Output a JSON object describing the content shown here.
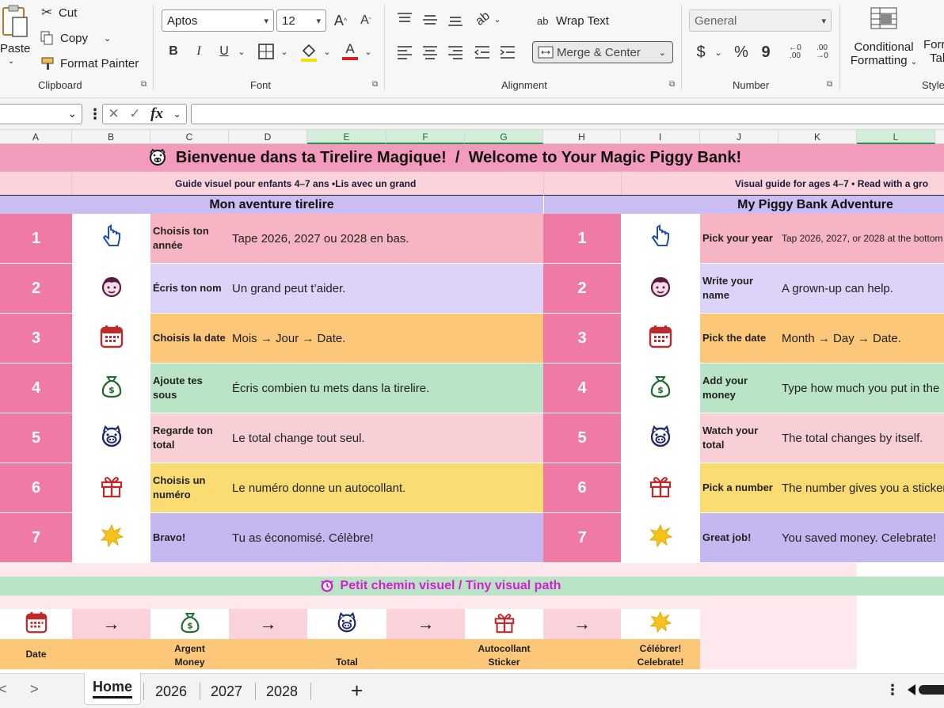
{
  "ribbon": {
    "clipboard": {
      "paste_label": "Paste",
      "cut_label": "Cut",
      "copy_label": "Copy",
      "format_painter_label": "Format Painter",
      "group_label": "Clipboard"
    },
    "font": {
      "font_name": "Aptos",
      "font_size": "12",
      "grow_label": "A",
      "shrink_label": "A",
      "bold_label": "B",
      "italic_label": "I",
      "underline_label": "U",
      "font_color_label": "A",
      "group_label": "Font"
    },
    "alignment": {
      "wrap_text_label": "Wrap Text",
      "wrap_text_glyph": "ab",
      "merge_center_label": "Merge & Center",
      "group_label": "Alignment"
    },
    "number": {
      "format_value": "General",
      "currency_label": "$",
      "percent_label": "%",
      "comma_label": "9",
      "increase_decimal_label": ".00",
      "decrease_decimal_label": ".00",
      "group_label": "Number"
    },
    "styles": {
      "conditional_formatting_line1": "Conditional",
      "conditional_formatting_line2": "Formatting",
      "format_table_line1": "Forr",
      "format_table_line2": "Tal",
      "group_label": "Style"
    }
  },
  "formula_bar": {
    "fx_label": "fx",
    "more_label": "⋮",
    "cancel_label": "✕",
    "enter_label": "✓"
  },
  "columns": [
    "A",
    "B",
    "C",
    "D",
    "E",
    "F",
    "G",
    "H",
    "I",
    "J",
    "K",
    "L"
  ],
  "sheet": {
    "title": "Bienvenue dans ta Tirelire Magique!  /  Welcome to Your Magic Piggy Bank!",
    "subtitle_fr": "Guide visuel pour enfants 4–7 ans •Lis avec un grand",
    "subtitle_en": "Visual guide for ages 4–7  • Read with a gro",
    "header_fr": "Mon aventure tirelire",
    "header_en": "My Piggy Bank Adventure",
    "steps": [
      {
        "num": "1",
        "icon": "pointing-hand-icon",
        "fr_title": "Choisis ton année",
        "fr_desc": "Tape 2026, 2027 ou 2028 en bas.",
        "en_title": "Pick your year",
        "en_desc": "Tap 2026, 2027, or 2028 at the bottom"
      },
      {
        "num": "2",
        "icon": "child-face-icon",
        "fr_title": "Écris ton nom",
        "fr_desc": "Un grand peut t’aider.",
        "en_title": "Write your name",
        "en_desc": "A grown-up can help."
      },
      {
        "num": "3",
        "icon": "calendar-icon",
        "fr_title": "Choisis la date",
        "fr_desc": "Mois → Jour → Date.",
        "en_title": "Pick the date",
        "en_desc": "Month → Day → Date."
      },
      {
        "num": "4",
        "icon": "money-bag-icon",
        "fr_title": "Ajoute tes sous",
        "fr_desc": "Écris combien tu mets dans la tirelire.",
        "en_title": "Add your money",
        "en_desc": "Type how much you put in the"
      },
      {
        "num": "5",
        "icon": "piggy-icon",
        "fr_title": "Regarde ton total",
        "fr_desc": "Le total change tout seul.",
        "en_title": "Watch your total",
        "en_desc": "The total changes by itself."
      },
      {
        "num": "6",
        "icon": "gift-icon",
        "fr_title": "Choisis un numéro",
        "fr_desc": "Le numéro donne un autocollant.",
        "en_title": "Pick a number",
        "en_desc": "The number gives you a sticker"
      },
      {
        "num": "7",
        "icon": "star-burst-icon",
        "fr_title": "Bravo!",
        "fr_desc": "Tu as économisé. Célèbre!",
        "en_title": "Great job!",
        "en_desc": "You saved money. Celebrate!"
      }
    ],
    "path_title": "Petit chemin visuel / Tiny visual path",
    "path_title_icon": "sparkle-clock-icon",
    "path_arrow": "→",
    "path": [
      {
        "icon": "calendar-icon",
        "label": "Date"
      },
      {
        "icon": "money-bag-icon",
        "label": "Argent\nMoney"
      },
      {
        "icon": "piggy-icon",
        "label": "Total"
      },
      {
        "icon": "gift-icon",
        "label": "Autocollant\nSticker"
      },
      {
        "icon": "star-burst-icon",
        "label": "Célébrer!\nCelebrate!"
      }
    ]
  },
  "tabs": {
    "items": [
      "Home",
      "2026",
      "2027",
      "2028"
    ],
    "active": "Home",
    "add_label": "+",
    "prev_label": "<",
    "next_label": ">",
    "more_label": "⋮"
  },
  "colors": {
    "title_pink": "#f39bbd",
    "subtitle_pink": "#fbd3dd",
    "header_lavender": "#c9bdf3",
    "number_pink": "#ef7aa5",
    "row_pink": "#f7b5c3",
    "row_lavender": "#ddd2f7",
    "row_orange": "#fcc779",
    "row_green": "#b9e4c5",
    "row_rose": "#f8cfd4",
    "row_yellow": "#fbdc73",
    "row_purple": "#c5b8f1",
    "path_green": "#b9e4c5",
    "path_title": "#d21fd0",
    "path_pink": "#fad3da",
    "path_label_orange": "#fcc779"
  }
}
